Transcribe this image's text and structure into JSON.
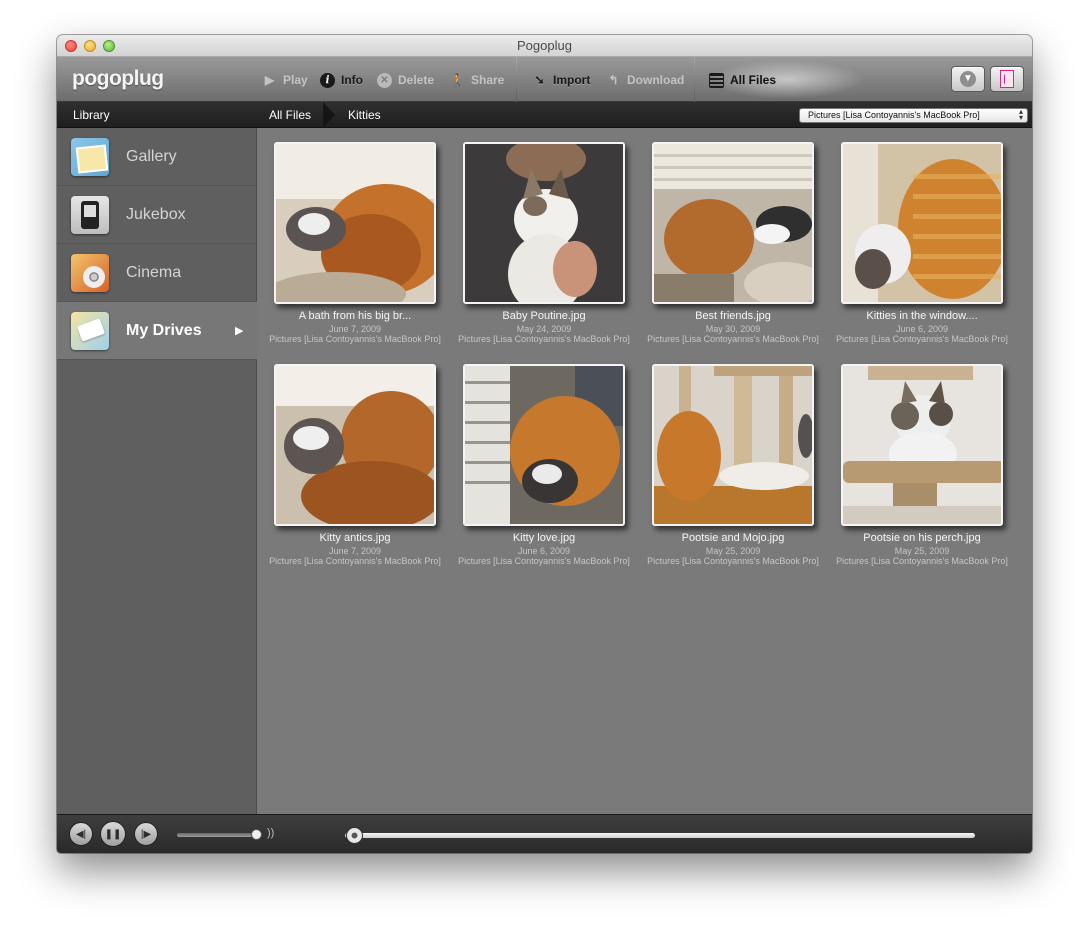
{
  "window": {
    "title": "Pogoplug"
  },
  "toolbar": {
    "logo": "pogoplug",
    "buttons": [
      {
        "label": "Play",
        "icon": "play-icon",
        "enabled": false
      },
      {
        "label": "Info",
        "icon": "info-icon",
        "enabled": true
      },
      {
        "label": "Delete",
        "icon": "delete-icon",
        "enabled": false
      },
      {
        "label": "Share",
        "icon": "share-icon",
        "enabled": false
      },
      {
        "label": "Import",
        "icon": "import-icon",
        "enabled": true
      },
      {
        "label": "Download",
        "icon": "download-icon",
        "enabled": false
      },
      {
        "label": "All Files",
        "icon": "all-files-icon",
        "enabled": true,
        "selected": true
      }
    ]
  },
  "breadcrumb": {
    "library": "Library",
    "items": [
      "All Files",
      "Kitties"
    ],
    "source_select": "Pictures [Lisa Contoyannis's MacBook Pro]"
  },
  "sidebar": {
    "items": [
      {
        "label": "Gallery",
        "icon": "gallery-icon",
        "active": false
      },
      {
        "label": "Jukebox",
        "icon": "jukebox-icon",
        "active": false
      },
      {
        "label": "Cinema",
        "icon": "cinema-icon",
        "active": false
      },
      {
        "label": "My Drives",
        "icon": "drives-icon",
        "active": true
      }
    ]
  },
  "files": [
    {
      "name": "A bath from his big br...",
      "date": "June 7, 2009",
      "source": "Pictures [Lisa Contoyannis's MacBook Pro]"
    },
    {
      "name": "Baby Poutine.jpg",
      "date": "May 24, 2009",
      "source": "Pictures [Lisa Contoyannis's MacBook Pro]"
    },
    {
      "name": "Best friends.jpg",
      "date": "May 30, 2009",
      "source": "Pictures [Lisa Contoyannis's MacBook Pro]"
    },
    {
      "name": "Kitties in the window....",
      "date": "June 6, 2009",
      "source": "Pictures [Lisa Contoyannis's MacBook Pro]"
    },
    {
      "name": "Kitty antics.jpg",
      "date": "June 7, 2009",
      "source": "Pictures [Lisa Contoyannis's MacBook Pro]"
    },
    {
      "name": "Kitty love.jpg",
      "date": "June 6, 2009",
      "source": "Pictures [Lisa Contoyannis's MacBook Pro]"
    },
    {
      "name": "Pootsie and Mojo.jpg",
      "date": "May 25, 2009",
      "source": "Pictures [Lisa Contoyannis's MacBook Pro]"
    },
    {
      "name": "Pootsie on his perch.jpg",
      "date": "May 25, 2009",
      "source": "Pictures [Lisa Contoyannis's MacBook Pro]"
    }
  ],
  "player": {
    "volume": 0.98,
    "position": 0.0
  },
  "colors": {
    "sidebar_bg": "#5f5f5f",
    "sidebar_active": "#777777",
    "content_bg": "#7a7a7a",
    "accent_exit": "#d22a7a"
  }
}
